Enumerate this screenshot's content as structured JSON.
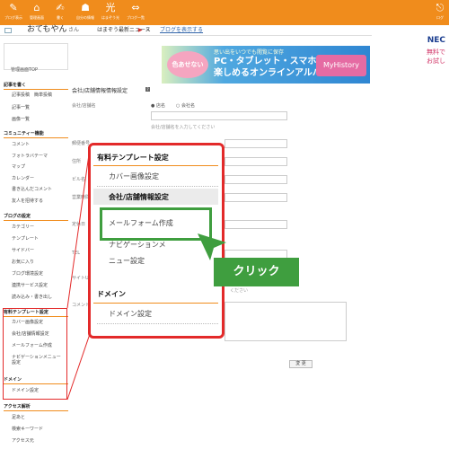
{
  "topbar": {
    "items": [
      {
        "glyph": "✎",
        "label": "ブログ表示",
        "icon": "blog-view-icon"
      },
      {
        "glyph": "⌂",
        "label": "管理画面",
        "icon": "home-icon"
      },
      {
        "glyph": "✍",
        "label": "書く",
        "icon": "write-icon"
      },
      {
        "glyph": "☗",
        "label": "自分の情報",
        "icon": "person-icon"
      },
      {
        "glyph": "光",
        "label": "はまぞう光",
        "icon": "hikari-icon"
      },
      {
        "glyph": "⇔",
        "label": "ブログ一覧",
        "icon": "blog-list-icon"
      }
    ],
    "right_label": "ログ"
  },
  "userrow": {
    "name": "おてもやん",
    "san": "さん",
    "news": "はまぞう最新ニュース",
    "news_arrow": "▶",
    "close": "×",
    "blog_link": "ブログを表示する"
  },
  "banner1": {
    "badge": "色あせない",
    "sub": "思い出をいつでも閲覧に保存",
    "main1": "PC・タブレット・スマホで",
    "main2": "楽しめるオンラインアルバム",
    "right": "MyHistory"
  },
  "banner2": {
    "nec": "NEC",
    "free": "無料で\nお試し"
  },
  "sidebar": {
    "top": "管理画面TOP",
    "sections": [
      {
        "heading": "記事を書く",
        "items": [
          "記事投稿　簡単投稿",
          "記事一覧",
          "画像一覧"
        ]
      },
      {
        "heading": "コミュニティー機能",
        "items": [
          "コメント",
          "フォトラバテーマ",
          "マップ",
          "カレンダー",
          "書き込んだコメント",
          "友人を招待する"
        ]
      },
      {
        "heading": "ブログの設定",
        "items": [
          "カテゴリー",
          "テンプレート",
          "サイドバー",
          "お気に入り",
          "ブログ環境設定",
          "連携サービス設定",
          "読み込み・書き出し"
        ]
      },
      {
        "heading": "有料テンプレート設定",
        "items": [
          "カバー画像設定",
          "会社/店舗情報設定",
          "メールフォーム作成",
          "ナビゲーションメニュー設定"
        ]
      },
      {
        "heading": "ドメイン",
        "items": [
          "ドメイン設定"
        ]
      },
      {
        "heading": "アクセス解析",
        "items": [
          "足あと",
          "検索キーワード",
          "アクセス元"
        ]
      }
    ]
  },
  "main": {
    "title": "会社/店舗情報情報設定",
    "qmark": "?",
    "label_name": "会社/店舗名",
    "radio1": "● 店名",
    "radio2": "○ 会社名",
    "hint_name": "会社/店舗名を入力してください",
    "label_zip": "郵便番号",
    "label_addr": "住所",
    "label_bldg": "ビル名",
    "label_hours": "営業時間",
    "label_holiday": "定休日",
    "label_tel": "TEL",
    "label_site": "サイトURL",
    "hint_site": "ください",
    "label_comment": "コメント",
    "submit": "変 更"
  },
  "popup": {
    "heading1": "有料テンプレート設定",
    "items": [
      "カバー画像設定",
      "会社/店舗情報設定",
      "メールフォーム作成",
      "ナビゲーションメ",
      "ニュー設定"
    ],
    "heading2": "ドメイン",
    "domain_item": "ドメイン設定"
  },
  "callout": {
    "label": "クリック"
  },
  "colors": {
    "topbar": "#f08c1c",
    "highlight_red": "#e32a2a",
    "callout_green": "#3f9e3f"
  }
}
